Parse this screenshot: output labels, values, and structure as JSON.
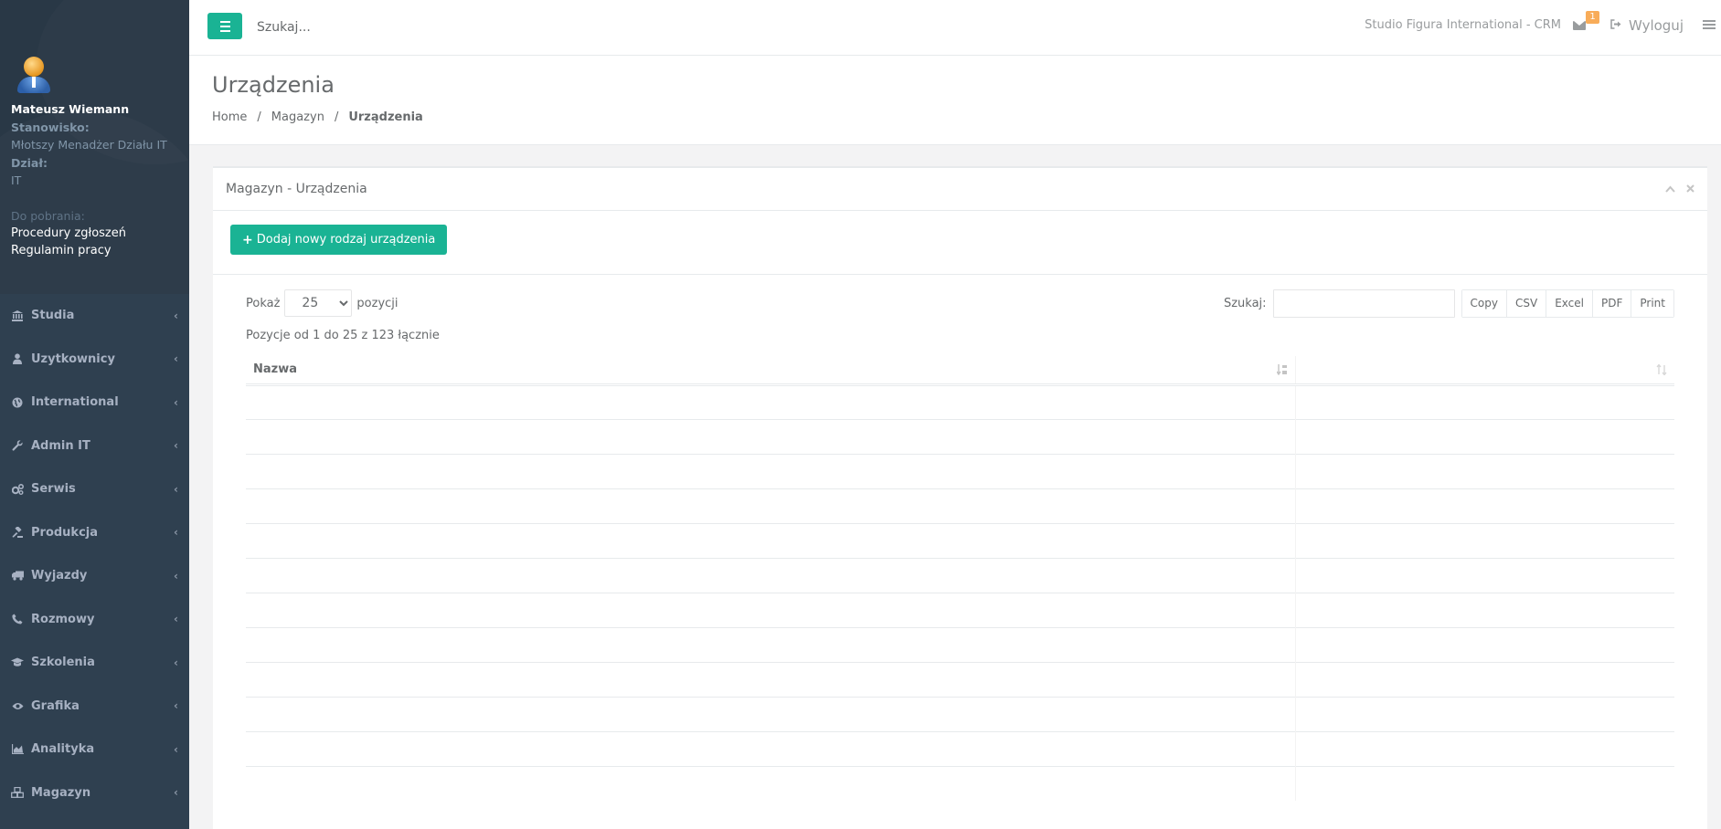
{
  "user": {
    "name": "Mateusz Wiemann",
    "position_label": "Stanowisko:",
    "position": "Młotszy Menadżer Działu IT",
    "department_label": "Dział:",
    "department": "IT",
    "downloads_label": "Do pobrania:",
    "downloads": [
      "Procedury zgłoszeń",
      "Regulamin pracy"
    ]
  },
  "nav": [
    {
      "label": "Studia",
      "icon": "bank-icon"
    },
    {
      "label": "Uzytkownicy",
      "icon": "user-icon"
    },
    {
      "label": "International",
      "icon": "globe-icon"
    },
    {
      "label": "Admin IT",
      "icon": "wrench-icon"
    },
    {
      "label": "Serwis",
      "icon": "cogs-icon"
    },
    {
      "label": "Produkcja",
      "icon": "gavel-icon"
    },
    {
      "label": "Wyjazdy",
      "icon": "truck-icon"
    },
    {
      "label": "Rozmowy",
      "icon": "phone-icon"
    },
    {
      "label": "Szkolenia",
      "icon": "graduation-cap-icon"
    },
    {
      "label": "Grafika",
      "icon": "eye-icon"
    },
    {
      "label": "Analityka",
      "icon": "area-chart-icon"
    },
    {
      "label": "Magazyn",
      "icon": "cubes-icon"
    }
  ],
  "topbar": {
    "search_placeholder": "Szukaj...",
    "brand": "Studio Figura International - CRM",
    "mail_count": "1",
    "logout": "Wyloguj"
  },
  "page": {
    "title": "Urządzenia",
    "breadcrumb": [
      "Home",
      "Magazyn",
      "Urządzenia"
    ]
  },
  "panel": {
    "title": "Magazyn - Urządzenia",
    "add_button": "Dodaj nowy rodzaj urządzenia",
    "show_label": "Pokaż",
    "length_value": "25",
    "entries_label": "pozycji",
    "search_label": "Szukaj:",
    "exports": [
      "Copy",
      "CSV",
      "Excel",
      "PDF",
      "Print"
    ],
    "info": "Pozycje od 1 do 25 z 123 łącznie",
    "columns": [
      "Nazwa",
      ""
    ]
  },
  "colors": {
    "accent": "#1ab394",
    "sidebar": "#2f4050",
    "badge": "#f8ac59"
  }
}
